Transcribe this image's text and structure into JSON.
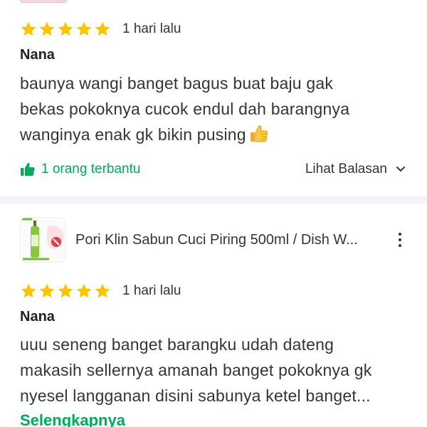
{
  "reviews": [
    {
      "rating": 5,
      "time": "1 hari lalu",
      "reviewer": "Nana",
      "text_lines": [
        "baunya wangi banget bagus buat baju gak",
        "bekas pokoknya cucok endul dah barangnya",
        "wanginya enak gk bikin pusing"
      ],
      "emoji_icon": "thumbs-up-emoji",
      "helpful": "1 orang terbantu",
      "replies_label": "Lihat Balasan"
    },
    {
      "product_name": "Pori Klin Sabun Cuci Piring 500ml / Dish W...",
      "rating": 5,
      "time": "1 hari lalu",
      "reviewer": "Nana",
      "text_lines": [
        "uuu seneng banget barangku udah dateng",
        "makasih sellernya amanah banget pokoknya gk",
        "nyesel langganan disini sabunya ketel banget..."
      ],
      "see_more": "Selengkapnya"
    }
  ],
  "colors": {
    "star": "#ffc400",
    "accent_green": "#00aa5b",
    "divider": "#f0f3f7"
  }
}
